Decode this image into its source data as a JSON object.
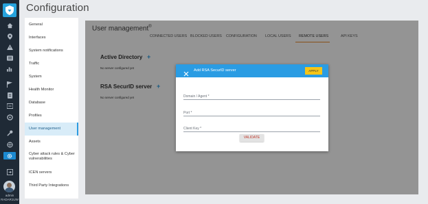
{
  "app": {
    "title": "Configuration"
  },
  "rail": {
    "icons": [
      "logo-icon",
      "home-icon",
      "location-pin-icon",
      "warning-icon",
      "list-icon",
      "bar-chart-icon",
      "blank-icon",
      "flag-icon",
      "document-icon",
      "code-icon",
      "settings-icon",
      "wrench-icon",
      "cloud-icon",
      "gear-icon",
      "exit-icon"
    ],
    "user_name": "admin",
    "user_host": "RADAR1UW"
  },
  "sidebar": {
    "items": [
      {
        "label": "General"
      },
      {
        "label": "Interfaces"
      },
      {
        "label": "System notifications"
      },
      {
        "label": "Traffic"
      },
      {
        "label": "System"
      },
      {
        "label": "Health Monitor"
      },
      {
        "label": "Database"
      },
      {
        "label": "Profiles"
      },
      {
        "label": "User management",
        "active": true
      },
      {
        "label": "Assets"
      },
      {
        "label": "Cyber attack rules & Cyber vulnerabilities"
      },
      {
        "label": "ICEN servers"
      },
      {
        "label": "Third Party Integrations"
      }
    ]
  },
  "main": {
    "section_title": "User management",
    "section_mark": "®",
    "tabs": [
      {
        "label": "CONNECTED USERS"
      },
      {
        "label": "BLOCKED USERS"
      },
      {
        "label": "CONFIGURATION"
      },
      {
        "label": "LOCAL USERS"
      },
      {
        "label": "REMOTE USERS",
        "active": true
      },
      {
        "label": "API KEYS"
      }
    ],
    "active_directory": {
      "title": "Active Directory",
      "empty_text": "No server configured yet"
    },
    "rsa": {
      "title": "RSA SecurID server",
      "empty_text": "No server configured yet"
    }
  },
  "modal": {
    "title": "Add RSA SecurID server",
    "apply_label": "APPLY",
    "fields": [
      {
        "label": "Domain / Agent *"
      },
      {
        "label": "Port *"
      },
      {
        "label": "Client Key *"
      }
    ],
    "validate_label": "VALIDATE"
  },
  "colors": {
    "rail_bg": "#1f2a36",
    "accent_blue": "#2a9ce3",
    "apply_yellow": "#f5c518",
    "tab_underline": "#e8882a",
    "validate_text": "#c0392b"
  }
}
